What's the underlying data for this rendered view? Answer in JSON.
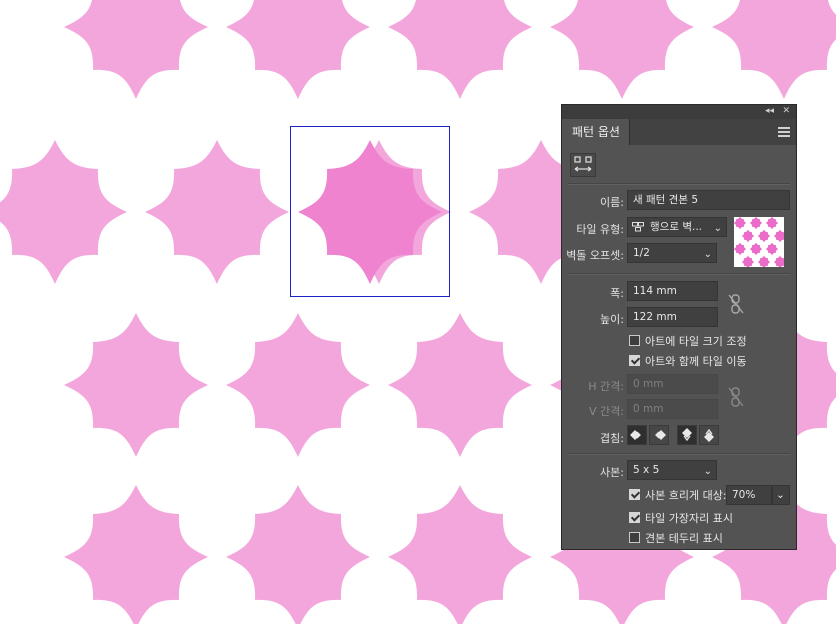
{
  "canvas": {
    "flower_color": "#f3a6dc",
    "selected_flower_color": "#ef83cf",
    "selection_border_color": "#1a23c8"
  },
  "panel": {
    "tab_title": "패턴 옵션",
    "collapse_icon": "double-chevron-icon",
    "close_icon": "close-icon",
    "menu_icon": "hamburger-menu-icon",
    "fit_button_icon": "tile-fit-icon",
    "name_label": "이름:",
    "name_value": "새 패턴 견본 5",
    "tile_type_label": "타일 유형:",
    "tile_type_value": "행으로 벽...",
    "brick_offset_label": "벽돌 오프셋:",
    "brick_offset_value": "1/2",
    "width_label": "폭:",
    "width_value": "114 mm",
    "height_label": "높이:",
    "height_value": "122 mm",
    "size_tile_to_art_label": "아트에 타일 크기 조정",
    "size_tile_to_art_checked": false,
    "move_tile_with_art_label": "아트와 함께 타일 이동",
    "move_tile_with_art_checked": true,
    "h_spacing_label": "H 간격:",
    "h_spacing_value": "0 mm",
    "v_spacing_label": "V 간격:",
    "v_spacing_value": "0 mm",
    "overlap_label": "겹침:",
    "copies_label": "사본:",
    "copies_value": "5 x 5",
    "dim_copies_label": "사본 흐리게 대상:",
    "dim_copies_checked": true,
    "dim_copies_value": "70%",
    "show_tile_edge_label": "타일 가장자리 표시",
    "show_tile_edge_checked": true,
    "show_swatch_bounds_label": "견본 테두리 표시",
    "show_swatch_bounds_checked": false
  }
}
